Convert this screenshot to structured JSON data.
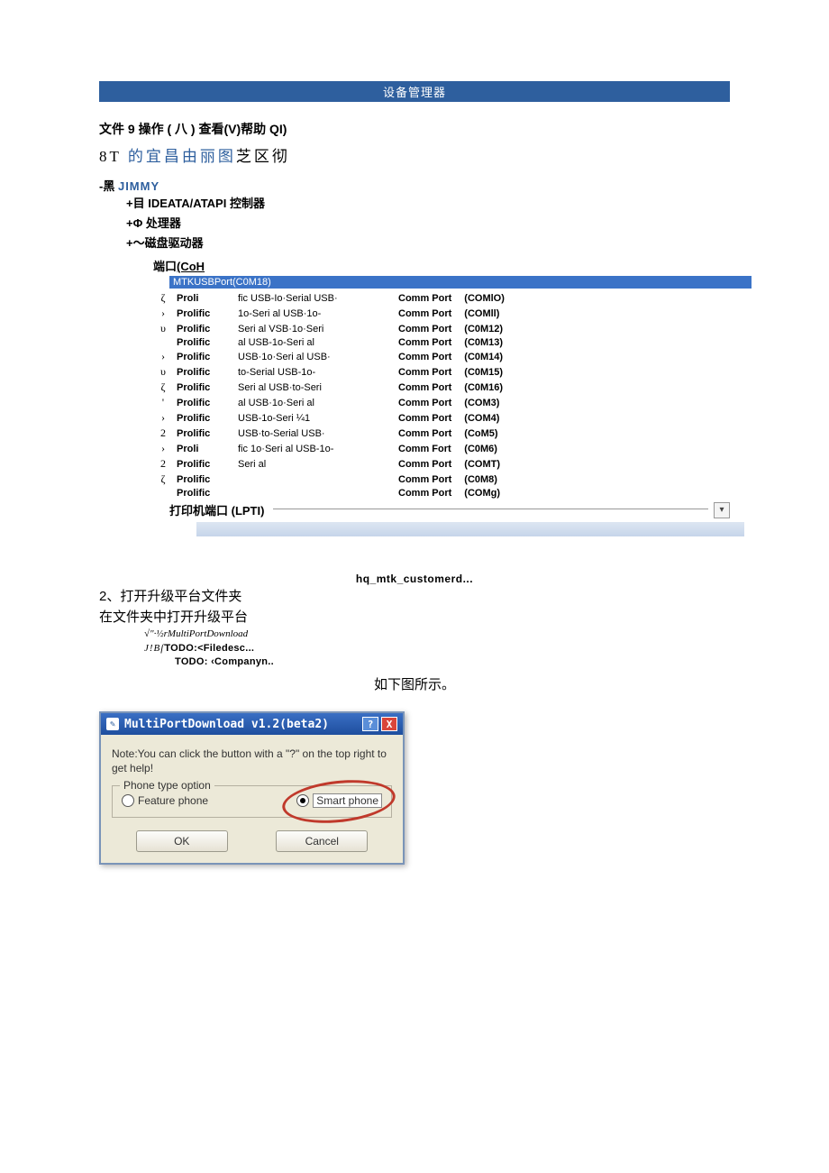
{
  "bar_title": "设备管理器",
  "menu_line": "文件 9 操作 ( 八 ) 查看(V)帮助 QI)",
  "serif_line_prefix": "8T ",
  "serif_line_blue": "的宜昌由丽图",
  "serif_line_suffix": "芝区彻",
  "root_dash": "-",
  "root_black": "黑 ",
  "root_jimmy": "JIMMY",
  "tree_items": [
    "+目 IDEATA/ATAPI 控制器",
    "+Φ 处理器",
    "+〜磁盘驱动器"
  ],
  "port_label_a": "端口",
  "port_label_b": "(CoH",
  "sel_bar": "MTKUSBPort(C0M18)",
  "ports": [
    {
      "g": "ζ",
      "brand": "Proli",
      "mid": "fic USB-Io·Serial  USB·",
      "cp": "Comm Port",
      "code": "(COMlO)"
    },
    {
      "g": "›",
      "brand": "Prolific",
      "mid": "1o-Seri  al  USB·1o-",
      "cp": "Comm Port",
      "code": "(COMll)"
    },
    {
      "g": "υ",
      "brand": "Prolific",
      "mid": "Seri  al VSB·1o·Seri",
      "cp": "Comm Port",
      "code": "(C0M12)"
    },
    {
      "g": "",
      "brand": "Prolific",
      "mid": "al  USB-1o-Seri  al",
      "cp": "Comm Port",
      "code": "(C0M13)"
    },
    {
      "g": "›",
      "brand": "Prolific",
      "mid": "USB·1o·Seri al USB·",
      "cp": "Comm Port",
      "code": "(C0M14)"
    },
    {
      "g": "υ",
      "brand": "Prolific",
      "mid": "to-Serial    USB-1o-",
      "cp": "Comm Port",
      "code": "(C0M15)"
    },
    {
      "g": "ζ",
      "brand": "Prolific",
      "mid": "Seri  al USB·to-Seri",
      "cp": "Comm Port",
      "code": "(C0M16)"
    },
    {
      "g": "'",
      "brand": "Prolific",
      "mid": "al  USB·1o·Seri  al",
      "cp": "Comm Port",
      "code": "(COM3)"
    },
    {
      "g": "›",
      "brand": "Prolific",
      "mid": "USB-1o-Seri       ¼1",
      "cp": "Comm Port",
      "code": "(COM4)"
    },
    {
      "g": "2",
      "brand": "Prolific",
      "mid": "USB·to-Serial  USB·",
      "cp": "Comm Port",
      "code": "(CoM5)"
    },
    {
      "g": "›",
      "brand": "Proli",
      "mid": "fic 1o·Seri  al  USB-1o-",
      "cp": "Comm Fort",
      "code": "(C0M6)"
    },
    {
      "g": "2",
      "brand": "Prolific",
      "mid": "Seri al",
      "cp": "Comm Port",
      "code": "(COMT)"
    },
    {
      "g": "ζ",
      "brand": "Prolific",
      "mid": "",
      "cp": "Comm Port",
      "code": "(C0M8)"
    },
    {
      "g": "",
      "brand": "Prolific",
      "mid": "",
      "cp": "Comm Port",
      "code": "(COMg)"
    }
  ],
  "printer_port": "打印机端口 (LPTI)",
  "center_bold": "hq_mtk_customerd...",
  "step2_a": "2、打开升级平台文件夹",
  "step2_b": "在文件夹中打开升级平台",
  "sub1": "√\"·½rMultiPortDownload",
  "sub2_a": "J!Bſ",
  "sub2_b": "TODO:<Filedesc...",
  "sub3": "TODO: ‹Companyn..",
  "below_fig": "如下图所示。",
  "dialog": {
    "title": "MultiPortDownload v1.2(beta2)",
    "help": "?",
    "close": "X",
    "note": "Note:You can click the button with a \"?\" on the top right to get help!",
    "legend": "Phone type option",
    "opt_feature": "Feature phone",
    "opt_smart": "Smart phone",
    "ok": "OK",
    "cancel": "Cancel"
  }
}
